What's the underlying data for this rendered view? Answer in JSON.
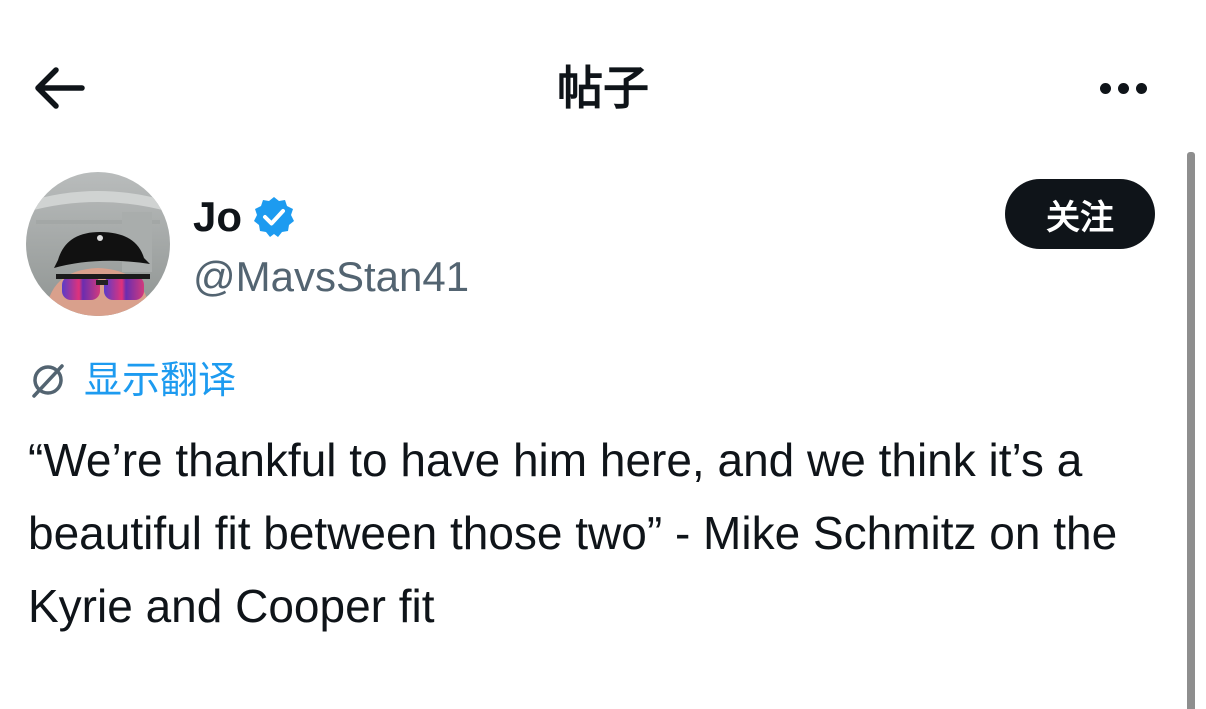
{
  "header": {
    "title": "帖子",
    "back_icon": "arrow-left-icon",
    "more_icon": "more-horizontal-icon"
  },
  "post": {
    "author": {
      "display_name": "Jo",
      "handle": "@MavsStan41",
      "verified": true,
      "verified_color": "#1d9bf0"
    },
    "follow_label": "关注",
    "translate_label": "显示翻译",
    "text": "“We’re thankful to have him here, and we think it’s a beautiful fit between those two” - Mike Schmitz on the Kyrie and Cooper fit"
  },
  "colors": {
    "text": "#0f1419",
    "secondary_text": "#536471",
    "accent": "#1d9bf0",
    "button_bg": "#0f1419",
    "button_text": "#ffffff"
  }
}
